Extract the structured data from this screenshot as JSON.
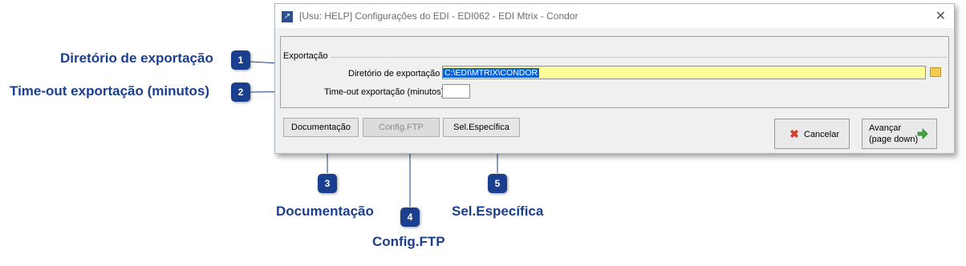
{
  "window": {
    "title": "[Usu: HELP] Configurações do EDI - EDI062 - EDI Mtrix - Condor",
    "close_glyph": "✕",
    "app_icon": "arrow-up-right-icon"
  },
  "group": {
    "legend": "Exportação",
    "dir_label": "Diretório  de exportação",
    "dir_value": "C:\\EDI\\MTRIX\\CONDOR",
    "timeout_label": "Time-out exportação (minutos)",
    "timeout_value": "",
    "folder_icon": "folder-icon"
  },
  "buttons": {
    "documentacao": "Documentação",
    "config_ftp": "Config.FTP",
    "sel_especifica": "Sel.Específica",
    "cancelar": "Cancelar",
    "avancar_line1": "Avançar",
    "avancar_line2": "(page down)"
  },
  "callouts": [
    {
      "num": "1",
      "label": "Diretório de exportação"
    },
    {
      "num": "2",
      "label": "Time-out exportação (minutos)"
    },
    {
      "num": "3",
      "label": "Documentação"
    },
    {
      "num": "4",
      "label": "Config.FTP"
    },
    {
      "num": "5",
      "label": "Sel.Específica"
    }
  ],
  "colors": {
    "badge": "#1b3f8f",
    "input_highlight": "#ffff99",
    "selection": "#0a64d8"
  }
}
